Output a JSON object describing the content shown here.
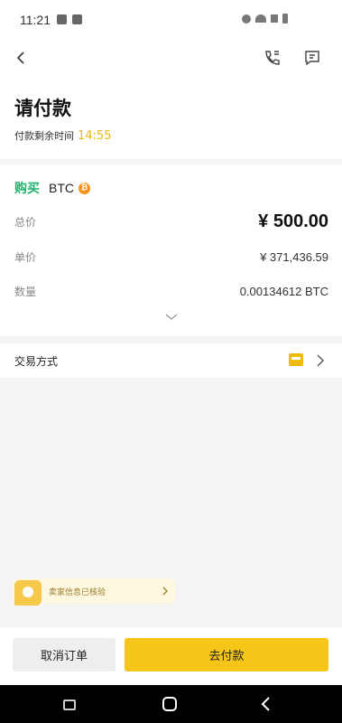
{
  "status_bar": {
    "time": "11:21"
  },
  "header": {
    "title": "请付款",
    "countdown_label": "付款剩余时间",
    "countdown_value": "14:55"
  },
  "order": {
    "action": "购买",
    "coin": "BTC",
    "rows": [
      {
        "label": "总价",
        "value": "¥ 500.00"
      },
      {
        "label": "单价",
        "value": "¥ 371,436.59"
      },
      {
        "label": "数量",
        "value": "0.00134612 BTC"
      }
    ]
  },
  "payment_method": {
    "label": "交易方式"
  },
  "notice": {
    "text": "卖家信息已核验"
  },
  "footer": {
    "cancel_label": "取消订单",
    "pay_label": "去付款"
  },
  "colors": {
    "accent": "#f5c518",
    "buy_green": "#20b26c",
    "timer": "#f0b90b"
  },
  "icons": [
    "back-icon",
    "phone-icon",
    "chat-icon",
    "btc-coin-icon",
    "chevron-down-icon",
    "payment-card-icon",
    "chevron-right-icon",
    "verified-icon"
  ]
}
